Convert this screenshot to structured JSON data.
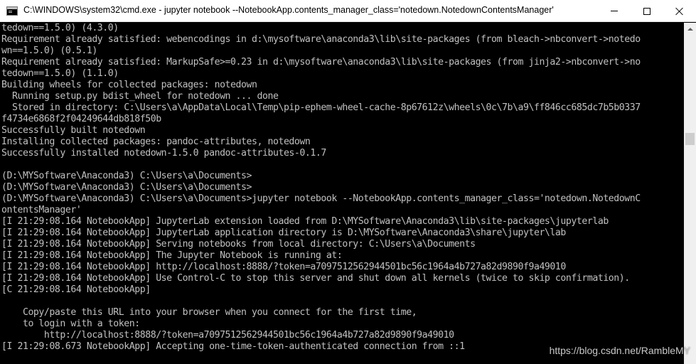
{
  "window": {
    "title": "C:\\WINDOWS\\system32\\cmd.exe - jupyter  notebook --NotebookApp.contents_manager_class='notedown.NotedownContentsManager'",
    "icon": "cmd-icon",
    "controls": {
      "minimize": "minimize-icon",
      "maximize": "maximize-icon",
      "close": "close-icon"
    }
  },
  "console": {
    "text_color": "#c0c0c0",
    "background": "#000000",
    "lines": [
      "tedown==1.5.0) (4.3.0)",
      "Requirement already satisfied: webencodings in d:\\mysoftware\\anaconda3\\lib\\site-packages (from bleach->nbconvert->notedo",
      "wn==1.5.0) (0.5.1)",
      "Requirement already satisfied: MarkupSafe>=0.23 in d:\\mysoftware\\anaconda3\\lib\\site-packages (from jinja2->nbconvert->no",
      "tedown==1.5.0) (1.1.0)",
      "Building wheels for collected packages: notedown",
      "  Running setup.py bdist_wheel for notedown ... done",
      "  Stored in directory: C:\\Users\\a\\AppData\\Local\\Temp\\pip-ephem-wheel-cache-8p67612z\\wheels\\0c\\7b\\a9\\ff846cc685dc7b5b0337",
      "f4734e6868f2f04249644db818f50b",
      "Successfully built notedown",
      "Installing collected packages: pandoc-attributes, notedown",
      "Successfully installed notedown-1.5.0 pandoc-attributes-0.1.7",
      "",
      "(D:\\MYSoftware\\Anaconda3) C:\\Users\\a\\Documents>",
      "(D:\\MYSoftware\\Anaconda3) C:\\Users\\a\\Documents>",
      "(D:\\MYSoftware\\Anaconda3) C:\\Users\\a\\Documents>jupyter notebook --NotebookApp.contents_manager_class='notedown.NotedownC",
      "ontentsManager'",
      "[I 21:29:08.164 NotebookApp] JupyterLab extension loaded from D:\\MYSoftware\\Anaconda3\\lib\\site-packages\\jupyterlab",
      "[I 21:29:08.164 NotebookApp] JupyterLab application directory is D:\\MYSoftware\\Anaconda3\\share\\jupyter\\lab",
      "[I 21:29:08.164 NotebookApp] Serving notebooks from local directory: C:\\Users\\a\\Documents",
      "[I 21:29:08.164 NotebookApp] The Jupyter Notebook is running at:",
      "[I 21:29:08.164 NotebookApp] http://localhost:8888/?token=a7097512562944501bc56c1964a4b727a82d9890f9a49010",
      "[I 21:29:08.164 NotebookApp] Use Control-C to stop this server and shut down all kernels (twice to skip confirmation).",
      "[C 21:29:08.164 NotebookApp]",
      "",
      "    Copy/paste this URL into your browser when you connect for the first time,",
      "    to login with a token:",
      "        http://localhost:8888/?token=a7097512562944501bc56c1964a4b727a82d9890f9a49010",
      "[I 21:29:08.673 NotebookApp] Accepting one-time-token-authenticated connection from ::1"
    ]
  },
  "watermark": "https://blog.csdn.net/RambleMY"
}
